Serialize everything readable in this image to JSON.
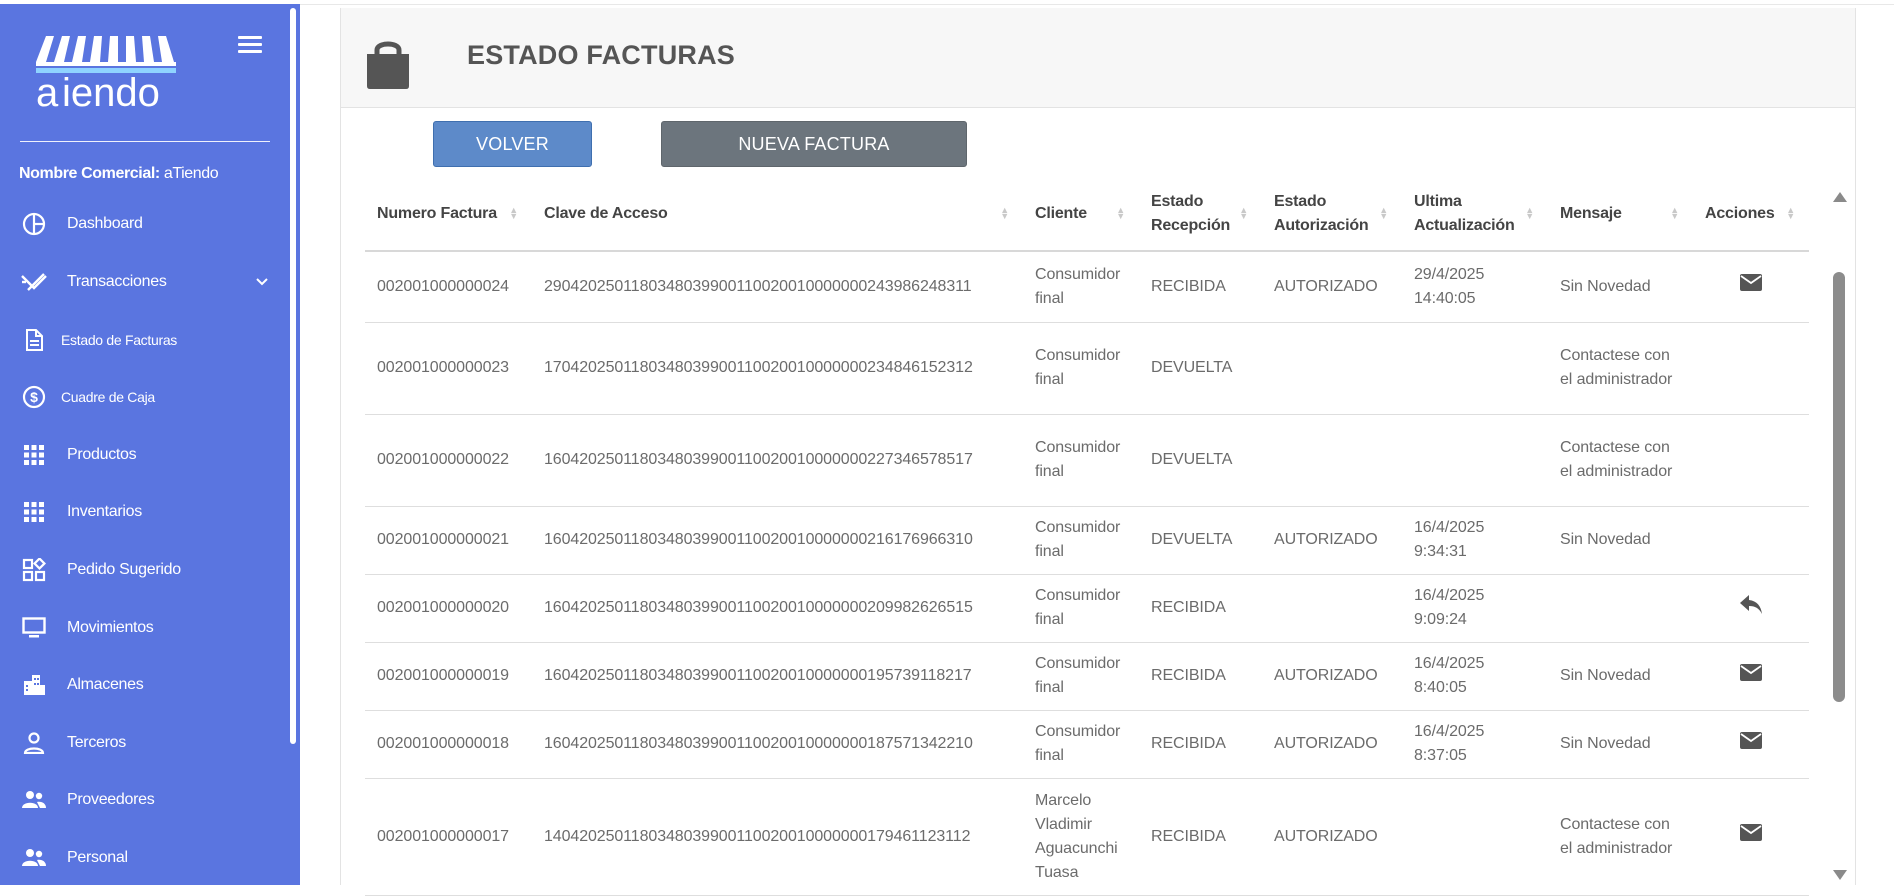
{
  "app": {
    "logo_text": "aTiendo"
  },
  "sidebar": {
    "commercial_label": "Nombre Comercial:",
    "commercial_value": "aTiendo",
    "items": [
      {
        "label": "Dashboard",
        "icon": "dashboard-icon"
      },
      {
        "label": "Transacciones",
        "icon": "transactions-icon"
      },
      {
        "label": "Estado de Facturas",
        "icon": "document-icon"
      },
      {
        "label": "Cuadre de Caja",
        "icon": "dollar-icon"
      },
      {
        "label": "Productos",
        "icon": "grid-icon"
      },
      {
        "label": "Inventarios",
        "icon": "grid-icon"
      },
      {
        "label": "Pedido Sugerido",
        "icon": "widgets-icon"
      },
      {
        "label": "Movimientos",
        "icon": "monitor-icon"
      },
      {
        "label": "Almacenes",
        "icon": "building-icon"
      },
      {
        "label": "Terceros",
        "icon": "person-icon"
      },
      {
        "label": "Proveedores",
        "icon": "people-icon"
      },
      {
        "label": "Personal",
        "icon": "people-icon"
      }
    ]
  },
  "header": {
    "title": "ESTADO FACTURAS"
  },
  "buttons": {
    "back": "VOLVER",
    "new": "NUEVA FACTURA"
  },
  "table": {
    "headers": {
      "numero": "Numero Factura",
      "clave": "Clave de Acceso",
      "cliente": "Cliente",
      "estado_recepcion_1": "Estado",
      "estado_recepcion_2": "Recepción",
      "estado_autorizacion_1": "Estado",
      "estado_autorizacion_2": "Autorización",
      "ultima_1": "Ultima",
      "ultima_2": "Actualización",
      "mensaje": "Mensaje",
      "acciones": "Acciones"
    },
    "rows": [
      {
        "numero": "002001000000024",
        "clave": "2904202501180348039900110020010000000243986248311",
        "cliente": "Consumidor final",
        "recepcion": "RECIBIDA",
        "autorizacion": "AUTORIZADO",
        "ultima": "29/4/2025 14:40:05",
        "mensaje": "Sin Novedad",
        "accion": "mail"
      },
      {
        "numero": "002001000000023",
        "clave": "1704202501180348039900110020010000000234846152312",
        "cliente": "Consumidor final",
        "recepcion": "DEVUELTA",
        "autorizacion": "",
        "ultima": "",
        "mensaje": "Contactese con el administrador",
        "accion": ""
      },
      {
        "numero": "002001000000022",
        "clave": "1604202501180348039900110020010000000227346578517",
        "cliente": "Consumidor final",
        "recepcion": "DEVUELTA",
        "autorizacion": "",
        "ultima": "",
        "mensaje": "Contactese con el administrador",
        "accion": ""
      },
      {
        "numero": "002001000000021",
        "clave": "1604202501180348039900110020010000000216176966310",
        "cliente": "Consumidor final",
        "recepcion": "DEVUELTA",
        "autorizacion": "AUTORIZADO",
        "ultima": "16/4/2025 9:34:31",
        "mensaje": "Sin Novedad",
        "accion": ""
      },
      {
        "numero": "002001000000020",
        "clave": "1604202501180348039900110020010000000209982626515",
        "cliente": "Consumidor final",
        "recepcion": "RECIBIDA",
        "autorizacion": "",
        "ultima": "16/4/2025 9:09:24",
        "mensaje": "",
        "accion": "reply"
      },
      {
        "numero": "002001000000019",
        "clave": "1604202501180348039900110020010000000195739118217",
        "cliente": "Consumidor final",
        "recepcion": "RECIBIDA",
        "autorizacion": "AUTORIZADO",
        "ultima": "16/4/2025 8:40:05",
        "mensaje": "Sin Novedad",
        "accion": "mail"
      },
      {
        "numero": "002001000000018",
        "clave": "1604202501180348039900110020010000000187571342210",
        "cliente": "Consumidor final",
        "recepcion": "RECIBIDA",
        "autorizacion": "AUTORIZADO",
        "ultima": "16/4/2025 8:37:05",
        "mensaje": "Sin Novedad",
        "accion": "mail"
      },
      {
        "numero": "002001000000017",
        "clave": "1404202501180348039900110020010000000179461123112",
        "cliente": "Marcelo Vladimir Aguacunchi Tuasa",
        "recepcion": "RECIBIDA",
        "autorizacion": "AUTORIZADO",
        "ultima": "",
        "mensaje": "Contactese con el administrador",
        "accion": "mail"
      }
    ]
  },
  "colors": {
    "sidebar": "#5a75e0",
    "back_button": "#5d8ac9",
    "new_button": "#6c757d"
  }
}
